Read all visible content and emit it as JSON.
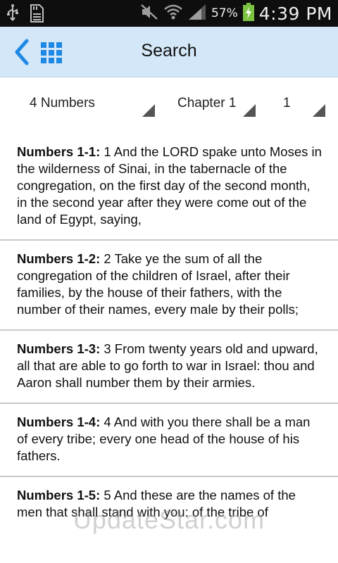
{
  "status_bar": {
    "battery_percent": "57%",
    "time": "4:39 PM",
    "icons": [
      "usb-icon",
      "sd-card-icon",
      "mute-icon",
      "wifi-icon",
      "signal-icon",
      "battery-charging-icon"
    ]
  },
  "app_bar": {
    "title": "Search",
    "back_icon": "chevron-left-icon",
    "grid_icon": "grid-icon",
    "accent_color": "#1e88e5",
    "background_color": "#d3e7f8"
  },
  "selectors": {
    "book": "4 Numbers",
    "chapter": "Chapter 1",
    "verse": "1"
  },
  "results": [
    {
      "ref": "Numbers 1-1:",
      "text": " 1 And the LORD spake unto Moses in the wilderness of Sinai, in the tabernacle of the congregation, on the first day of the second month, in the second year after they were come out of the land of Egypt, saying,"
    },
    {
      "ref": "Numbers 1-2:",
      "text": " 2 Take ye the sum of all the congregation of the children of Israel, after their families, by the house of their fathers, with the number of their names, every male by their polls;"
    },
    {
      "ref": "Numbers 1-3:",
      "text": " 3 From twenty years old and upward, all that are able to go forth to war in Israel: thou and Aaron shall number them by their armies."
    },
    {
      "ref": "Numbers 1-4:",
      "text": " 4 And with you there shall be a man of every tribe; every one head of the house of his fathers."
    },
    {
      "ref": "Numbers 1-5:",
      "text": " 5 And these are the names of the men that shall stand with you: of the tribe of"
    }
  ],
  "watermark": "UpdateStar.com"
}
